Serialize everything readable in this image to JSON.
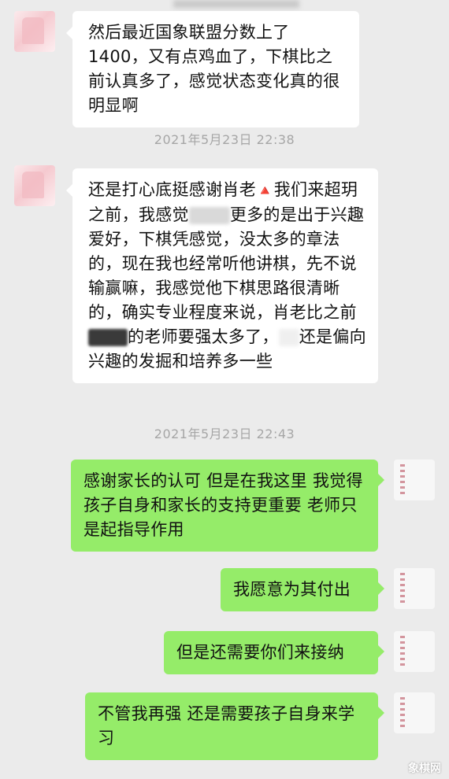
{
  "messages": [
    {
      "side": "left",
      "text": "然后最近国象联盟分数上了1400，又有点鸡血了，下棋比之前认真多了，感觉状态变化真的很明显啊"
    },
    {
      "type": "timestamp",
      "text": "2021年5月23日 22:38"
    },
    {
      "side": "left",
      "parts": [
        "还是打心底挺感谢肖老",
        "🔺",
        "我们来超玥之前，我感觉",
        "更多的是出于兴趣爱好，下棋凭感觉，没太多的章法的，现在我也经常听他讲棋，先不说输赢嘛，我感觉他下棋思路很清晰的，确实专业程度来说，肖老比之前",
        "的老师要强太多了，",
        "还是偏向兴趣的发掘和培养多一些"
      ]
    },
    {
      "type": "timestamp",
      "text": "2021年5月23日 22:43"
    },
    {
      "side": "right",
      "text": "感谢家长的认可 但是在我这里 我觉得孩子自身和家长的支持更重要 老师只是起指导作用"
    },
    {
      "side": "right",
      "text": "我愿意为其付出"
    },
    {
      "side": "right",
      "text": "但是还需要你们来接纳"
    },
    {
      "side": "right",
      "text": "不管我再强 还是需要孩子自身来学习"
    }
  ],
  "watermark": "象棋网",
  "colors": {
    "background": "#ebebeb",
    "left_bubble": "#ffffff",
    "right_bubble": "#95ec69",
    "timestamp": "#a6a6a6"
  }
}
